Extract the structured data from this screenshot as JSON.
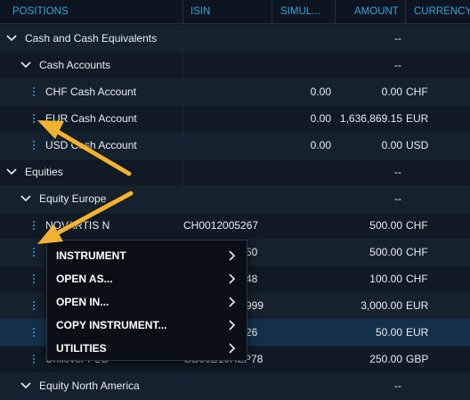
{
  "header": {
    "positions": "POSITIONS",
    "isin": "ISIN",
    "simul": "SIMUL...",
    "amount": "AMOUNT",
    "currency": "CURRENCY"
  },
  "rows": [
    {
      "label": "Cash and Cash Equivalents",
      "isin": "",
      "simul": "",
      "amount": "--",
      "currency": ""
    },
    {
      "label": "Cash Accounts",
      "isin": "",
      "simul": "",
      "amount": "--",
      "currency": ""
    },
    {
      "label": "CHF Cash Account",
      "isin": "",
      "simul": "0.00",
      "amount": "0.00",
      "currency": "CHF"
    },
    {
      "label": "EUR Cash Account",
      "isin": "",
      "simul": "0.00",
      "amount": "1,636,869.15",
      "currency": "EUR"
    },
    {
      "label": "USD Cash Account",
      "isin": "",
      "simul": "0.00",
      "amount": "0.00",
      "currency": "USD"
    },
    {
      "label": "Equities",
      "isin": "",
      "simul": "",
      "amount": "--",
      "currency": ""
    },
    {
      "label": "Equity Europe",
      "isin": "",
      "simul": "",
      "amount": "--",
      "currency": ""
    },
    {
      "label": "NOVARTIS N",
      "isin": "CH0012005267",
      "simul": "",
      "amount": "500.00",
      "currency": "CHF"
    },
    {
      "label": "",
      "isin": "50",
      "simul": "",
      "amount": "500.00",
      "currency": "CHF"
    },
    {
      "label": "",
      "isin": "48",
      "simul": "",
      "amount": "100.00",
      "currency": "CHF"
    },
    {
      "label": "",
      "isin": "999",
      "simul": "",
      "amount": "3,000.00",
      "currency": "EUR"
    },
    {
      "label": "",
      "isin": "26",
      "simul": "",
      "amount": "50.00",
      "currency": "EUR"
    },
    {
      "label": "Unilever PLC",
      "isin": "GB00B10RZP78",
      "simul": "",
      "amount": "250.00",
      "currency": "GBP"
    },
    {
      "label": "Equity North America",
      "isin": "",
      "simul": "",
      "amount": "--",
      "currency": ""
    }
  ],
  "context_menu": {
    "items": [
      "INSTRUMENT",
      "OPEN AS...",
      "OPEN IN...",
      "COPY INSTRUMENT...",
      "UTILITIES"
    ]
  },
  "colors": {
    "background": "#0f1a25",
    "header_text": "#3ba3d8",
    "accent_dots": "#3ba3d8",
    "annotation_arrow": "#f2b330"
  }
}
